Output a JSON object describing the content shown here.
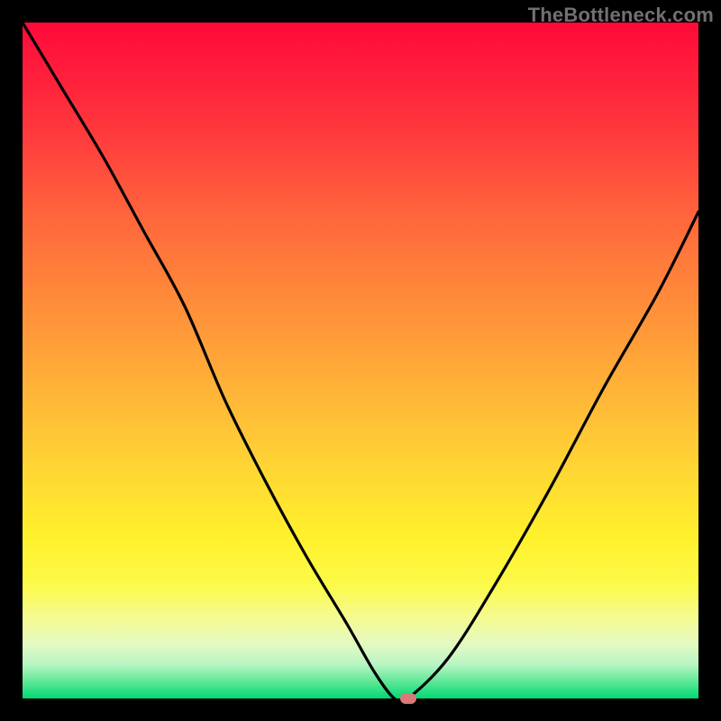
{
  "watermark": "TheBottleneck.com",
  "chart_data": {
    "type": "line",
    "title": "",
    "xlabel": "",
    "ylabel": "",
    "xlim": [
      0,
      100
    ],
    "ylim": [
      0,
      100
    ],
    "x": [
      0,
      6,
      12,
      18,
      24,
      30,
      36,
      42,
      48,
      52,
      55,
      57,
      63,
      70,
      78,
      86,
      94,
      100
    ],
    "values": [
      100,
      90,
      80,
      69,
      58,
      44,
      32,
      21,
      11,
      4,
      0,
      0,
      6,
      17,
      31,
      46,
      60,
      72
    ],
    "marker": {
      "x": 57,
      "y": 0
    },
    "colors": {
      "curve": "#000000",
      "marker": "#d87a7a",
      "gradient_top": "#ff0a3a",
      "gradient_bottom": "#00d874"
    }
  }
}
